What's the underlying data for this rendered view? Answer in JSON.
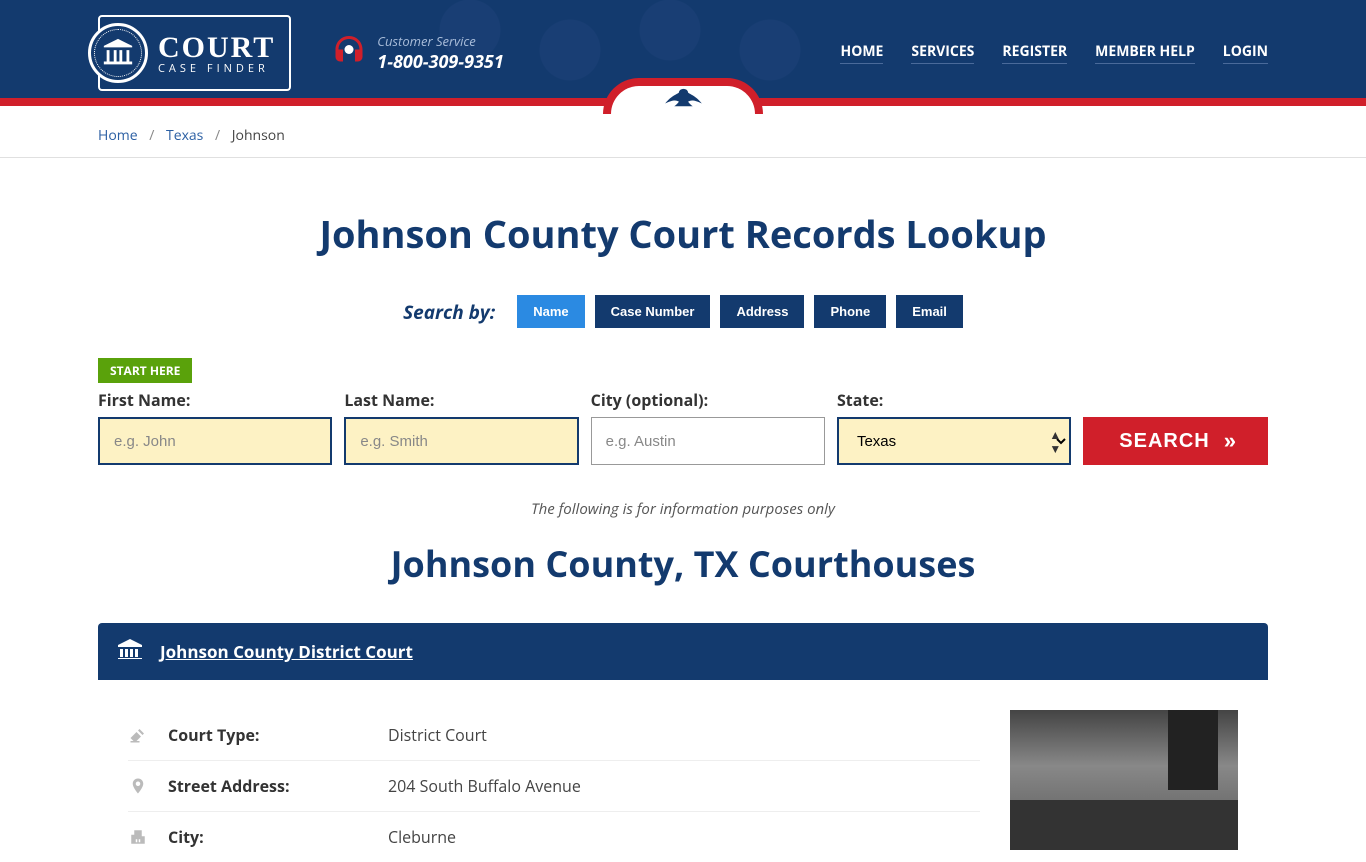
{
  "header": {
    "logo_big": "COURT",
    "logo_small": "CASE FINDER",
    "service_label": "Customer Service",
    "service_phone": "1-800-309-9351"
  },
  "nav": {
    "home": "HOME",
    "services": "SERVICES",
    "register": "REGISTER",
    "help": "MEMBER HELP",
    "login": "LOGIN"
  },
  "breadcrumb": {
    "home": "Home",
    "state": "Texas",
    "current": "Johnson"
  },
  "page_title": "Johnson County Court Records Lookup",
  "search_by": {
    "label": "Search by:",
    "tabs": {
      "name": "Name",
      "case": "Case Number",
      "address": "Address",
      "phone": "Phone",
      "email": "Email"
    }
  },
  "form": {
    "start_here": "START HERE",
    "first_name": {
      "label": "First Name:",
      "placeholder": "e.g. John"
    },
    "last_name": {
      "label": "Last Name:",
      "placeholder": "e.g. Smith"
    },
    "city": {
      "label": "City (optional):",
      "placeholder": "e.g. Austin"
    },
    "state": {
      "label": "State:",
      "value": "Texas"
    },
    "search_btn": "SEARCH"
  },
  "disclaimer": "The following is for information purposes only",
  "section_title": "Johnson County, TX Courthouses",
  "court": {
    "name": "Johnson County District Court",
    "rows": {
      "type": {
        "key": "Court Type:",
        "val": "District Court"
      },
      "address": {
        "key": "Street Address:",
        "val": "204 South Buffalo Avenue"
      },
      "city": {
        "key": "City:",
        "val": "Cleburne"
      }
    }
  }
}
